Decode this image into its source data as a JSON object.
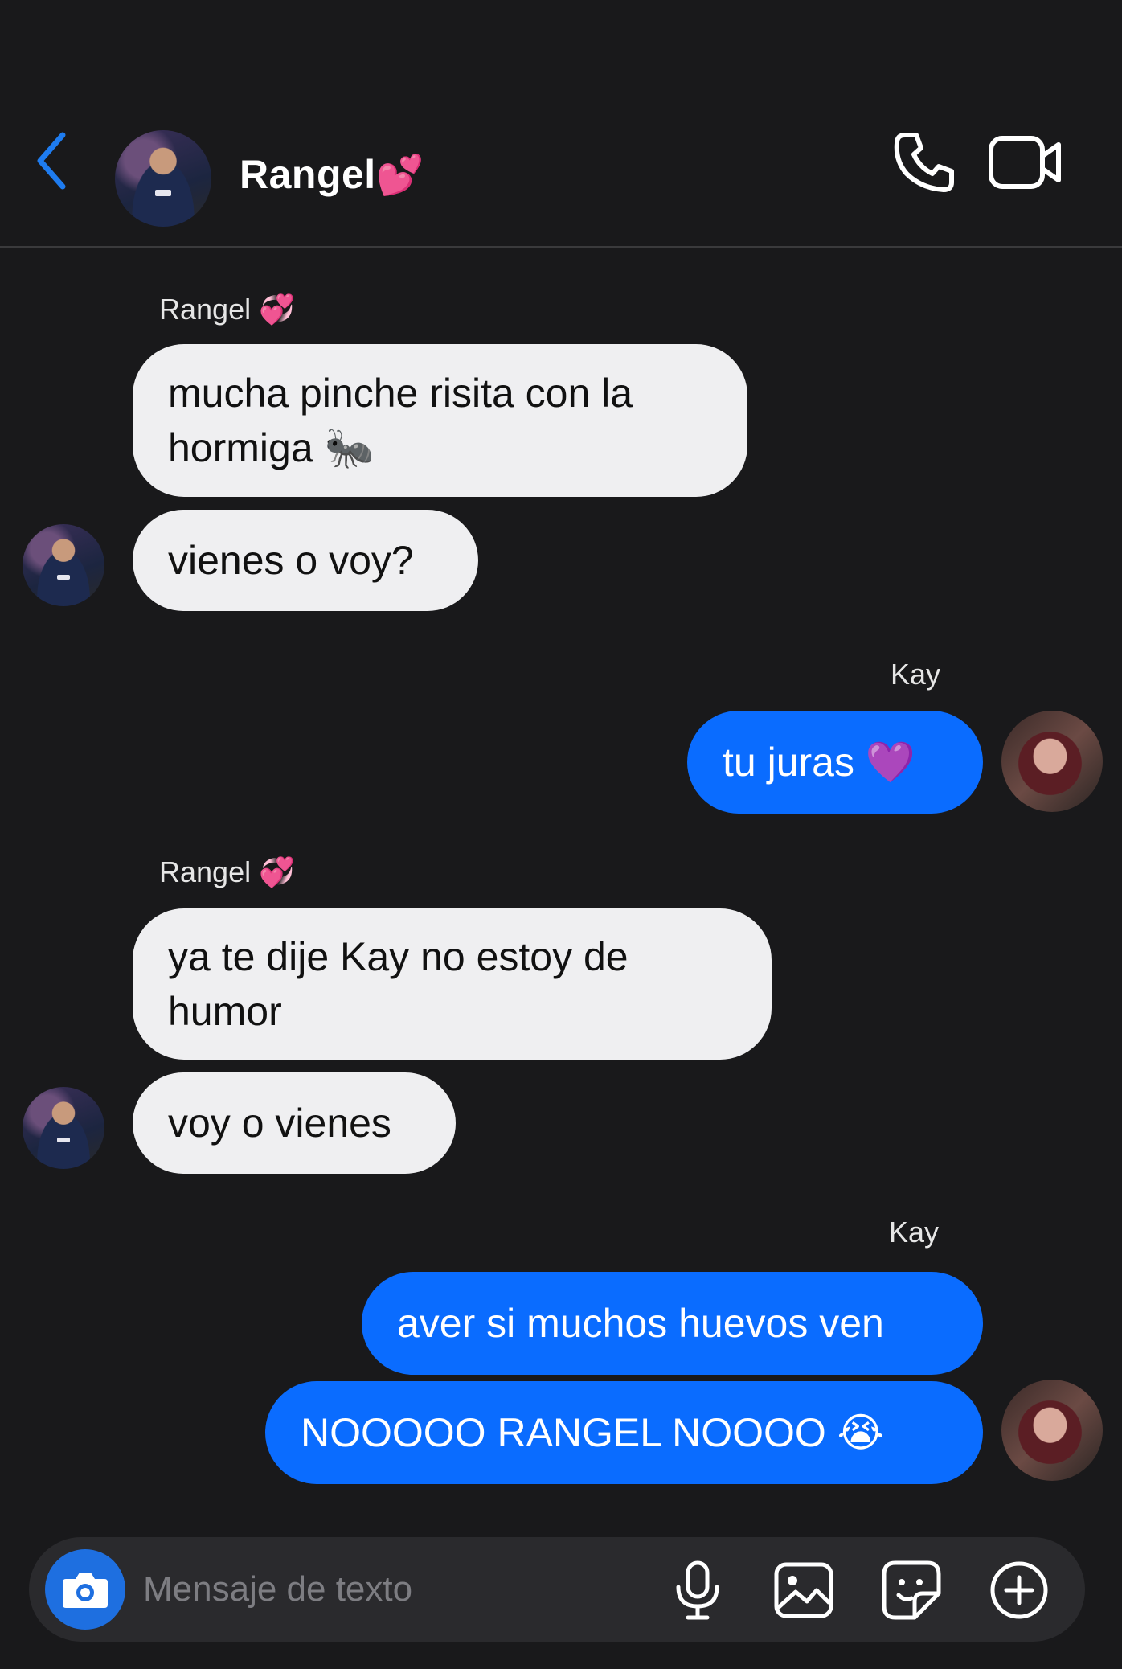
{
  "header": {
    "contact_name": "Rangel",
    "contact_emoji": "💕",
    "icons": [
      "back-chevron-icon",
      "phone-icon",
      "video-camera-icon"
    ]
  },
  "messages": [
    {
      "sender": "Rangel",
      "sender_emoji": "💞",
      "direction": "incoming",
      "bubbles": [
        "mucha pinche risita con la hormiga 🐜",
        "vienes o voy?"
      ]
    },
    {
      "sender": "Kay",
      "direction": "outgoing",
      "bubbles": [
        "tu juras 💜"
      ]
    },
    {
      "sender": "Rangel",
      "sender_emoji": "💞",
      "direction": "incoming",
      "bubbles": [
        "ya te dije Kay no estoy de humor",
        "voy o vienes"
      ]
    },
    {
      "sender": "Kay",
      "direction": "outgoing",
      "bubbles": [
        "aver si muchos huevos ven",
        "NOOOOO RANGEL NOOOO 😭"
      ]
    }
  ],
  "composer": {
    "placeholder": "Mensaje de texto",
    "icons": [
      "camera-icon",
      "microphone-icon",
      "image-icon",
      "sticker-icon",
      "plus-circle-icon"
    ]
  },
  "colors": {
    "background": "#19191b",
    "incoming_bubble": "#efeff1",
    "outgoing_bubble": "#0a6cff",
    "accent": "#1e6fe0"
  }
}
